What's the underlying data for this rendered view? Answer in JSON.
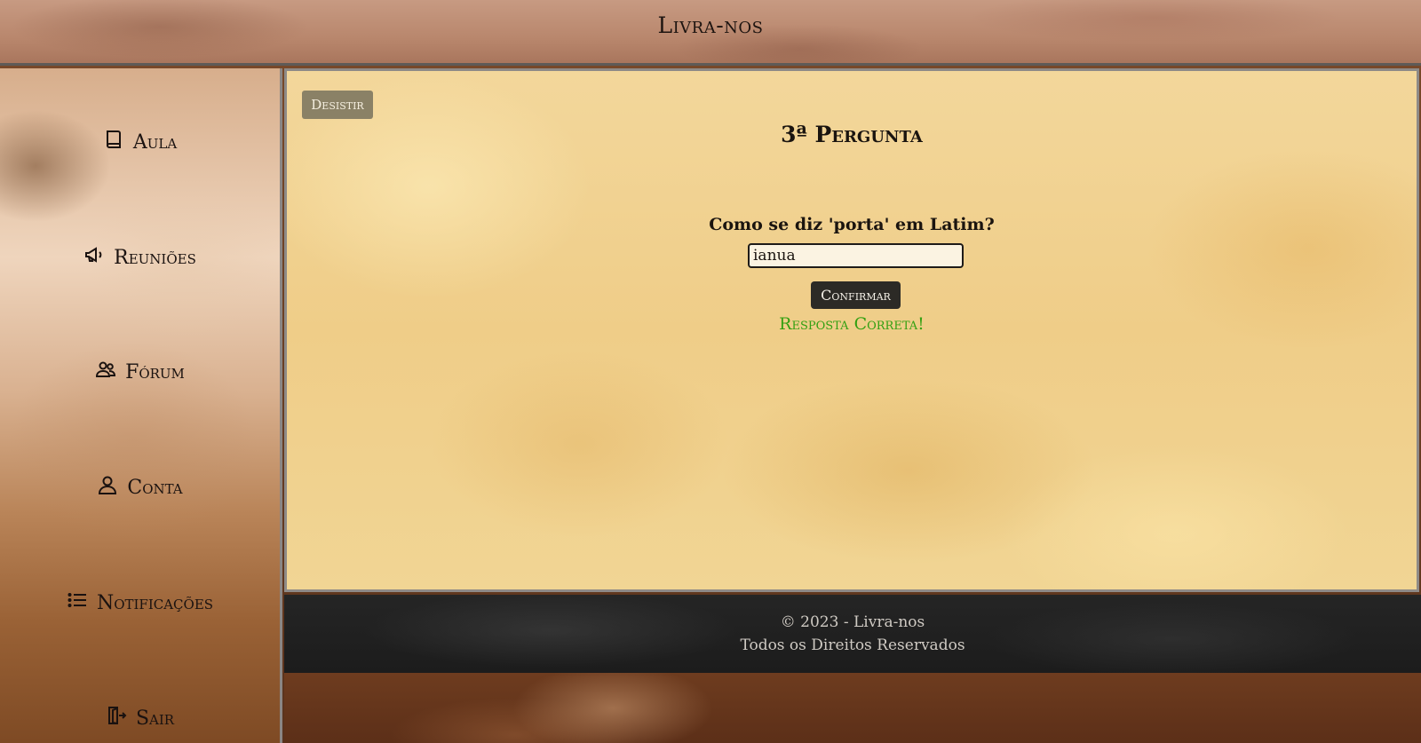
{
  "header": {
    "title": "Livra-nos"
  },
  "sidebar": {
    "items": [
      {
        "label": "Aula",
        "icon": "book-icon"
      },
      {
        "label": "Reuniões",
        "icon": "megaphone-icon"
      },
      {
        "label": "Fórum",
        "icon": "users-icon"
      },
      {
        "label": "Conta",
        "icon": "user-icon"
      },
      {
        "label": "Notificações",
        "icon": "list-icon"
      },
      {
        "label": "Sair",
        "icon": "exit-icon"
      }
    ]
  },
  "quiz": {
    "quit_label": "Desistir",
    "heading": "3ª Pergunta",
    "question": "Como se diz 'porta' em Latim?",
    "answer_value": "ianua",
    "confirm_label": "Confirmar",
    "result": "Resposta Correta!",
    "result_color": "#33a012"
  },
  "footer": {
    "line1": "© 2023 - Livra-nos",
    "line2": "Todos os Direitos Reservados"
  }
}
